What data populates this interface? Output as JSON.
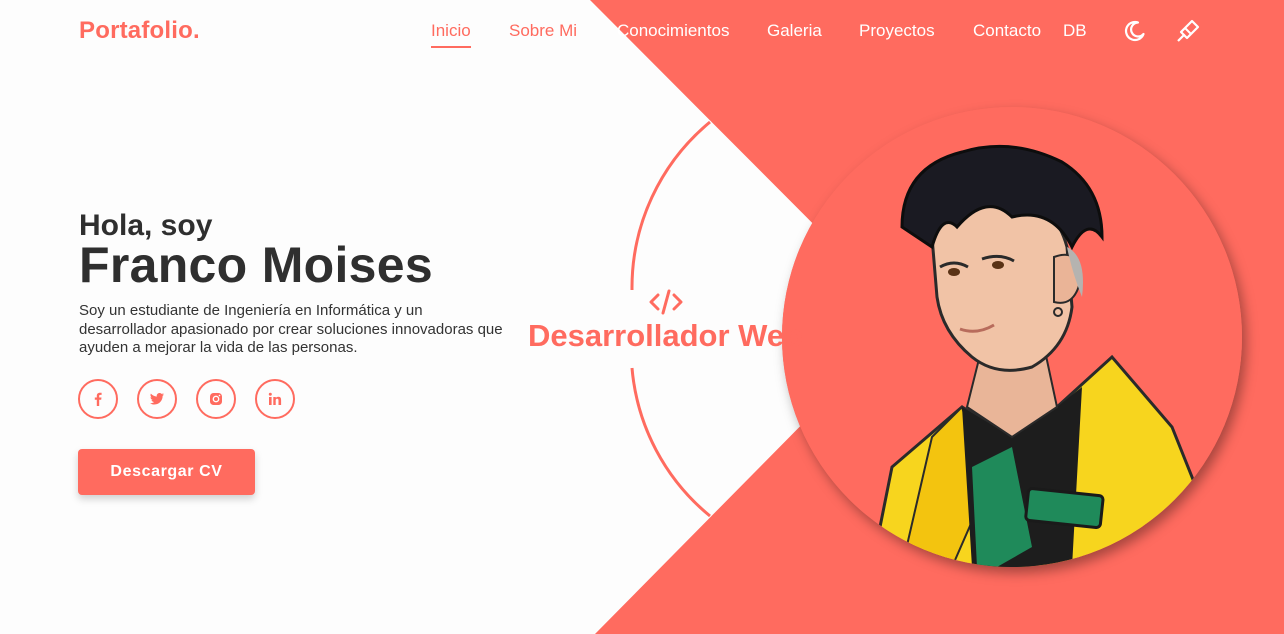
{
  "header": {
    "logo": "Portafolio.",
    "nav": [
      {
        "label": "Inicio"
      },
      {
        "label": "Sobre Mi"
      },
      {
        "label": "Conocimientos"
      },
      {
        "label": "Galeria"
      },
      {
        "label": "Proyectos"
      },
      {
        "label": "Contacto"
      },
      {
        "label": "DB"
      }
    ],
    "icons": [
      "moon-icon",
      "paint-brush-icon"
    ]
  },
  "hero": {
    "greeting": "Hola, soy",
    "name": "Franco Moises",
    "description": "Soy un estudiante de Ingeniería en Informática y un desarrollador apasionado por crear soluciones innovadoras que ayuden a mejorar la vida de las personas.",
    "socials": [
      "facebook-icon",
      "twitter-icon",
      "instagram-icon",
      "linkedin-icon"
    ],
    "cv_button": "Descargar CV",
    "role_icon": "code-icon",
    "role": "Desarrollador Web",
    "portrait": "portrait-image"
  },
  "colors": {
    "accent": "#ff6b5f",
    "text": "#2f2f2f",
    "background": "#fdfdfd"
  }
}
